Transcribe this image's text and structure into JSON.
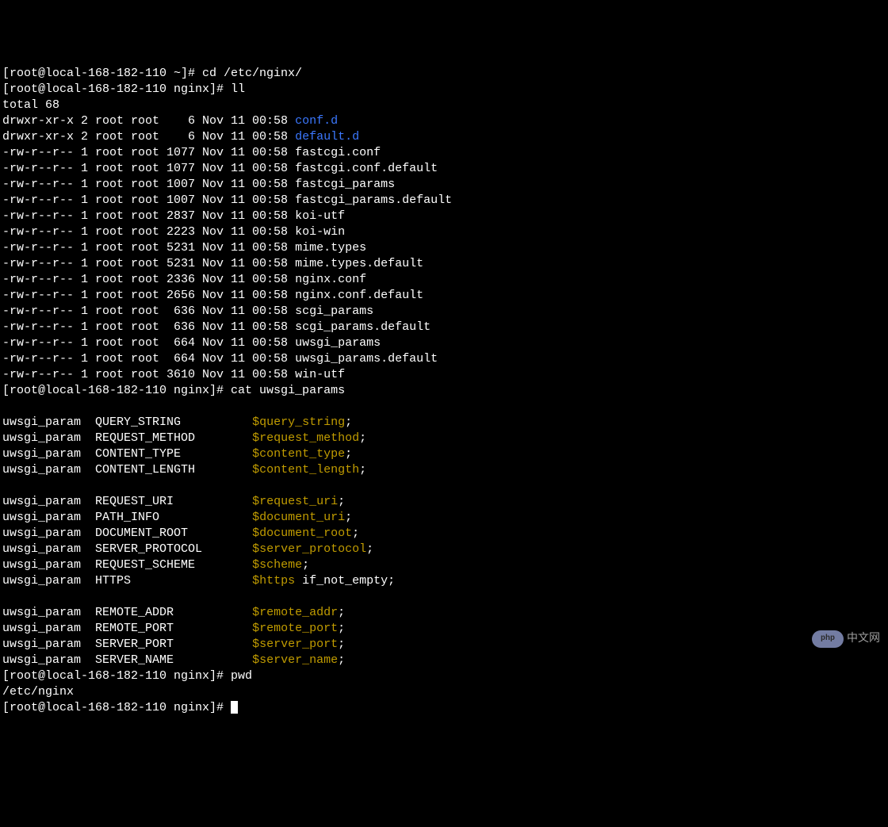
{
  "prompts": {
    "host_home": "[root@local-168-182-110 ~]#",
    "host_nginx": "[root@local-168-182-110 nginx]#"
  },
  "commands": {
    "cd": "cd /etc/nginx/",
    "ll": "ll",
    "cat": "cat uwsgi_params",
    "pwd": "pwd",
    "pwd_output": "/etc/nginx"
  },
  "ll_total": "total 68",
  "ll_rows": [
    {
      "perm": "drwxr-xr-x",
      "links": "2",
      "owner": "root",
      "group": "root",
      "size": "6",
      "month": "Nov",
      "day": "11",
      "time": "00:58",
      "name": "conf.d",
      "type": "dir"
    },
    {
      "perm": "drwxr-xr-x",
      "links": "2",
      "owner": "root",
      "group": "root",
      "size": "6",
      "month": "Nov",
      "day": "11",
      "time": "00:58",
      "name": "default.d",
      "type": "dir"
    },
    {
      "perm": "-rw-r--r--",
      "links": "1",
      "owner": "root",
      "group": "root",
      "size": "1077",
      "month": "Nov",
      "day": "11",
      "time": "00:58",
      "name": "fastcgi.conf",
      "type": "file"
    },
    {
      "perm": "-rw-r--r--",
      "links": "1",
      "owner": "root",
      "group": "root",
      "size": "1077",
      "month": "Nov",
      "day": "11",
      "time": "00:58",
      "name": "fastcgi.conf.default",
      "type": "file"
    },
    {
      "perm": "-rw-r--r--",
      "links": "1",
      "owner": "root",
      "group": "root",
      "size": "1007",
      "month": "Nov",
      "day": "11",
      "time": "00:58",
      "name": "fastcgi_params",
      "type": "file"
    },
    {
      "perm": "-rw-r--r--",
      "links": "1",
      "owner": "root",
      "group": "root",
      "size": "1007",
      "month": "Nov",
      "day": "11",
      "time": "00:58",
      "name": "fastcgi_params.default",
      "type": "file"
    },
    {
      "perm": "-rw-r--r--",
      "links": "1",
      "owner": "root",
      "group": "root",
      "size": "2837",
      "month": "Nov",
      "day": "11",
      "time": "00:58",
      "name": "koi-utf",
      "type": "file"
    },
    {
      "perm": "-rw-r--r--",
      "links": "1",
      "owner": "root",
      "group": "root",
      "size": "2223",
      "month": "Nov",
      "day": "11",
      "time": "00:58",
      "name": "koi-win",
      "type": "file"
    },
    {
      "perm": "-rw-r--r--",
      "links": "1",
      "owner": "root",
      "group": "root",
      "size": "5231",
      "month": "Nov",
      "day": "11",
      "time": "00:58",
      "name": "mime.types",
      "type": "file"
    },
    {
      "perm": "-rw-r--r--",
      "links": "1",
      "owner": "root",
      "group": "root",
      "size": "5231",
      "month": "Nov",
      "day": "11",
      "time": "00:58",
      "name": "mime.types.default",
      "type": "file"
    },
    {
      "perm": "-rw-r--r--",
      "links": "1",
      "owner": "root",
      "group": "root",
      "size": "2336",
      "month": "Nov",
      "day": "11",
      "time": "00:58",
      "name": "nginx.conf",
      "type": "file"
    },
    {
      "perm": "-rw-r--r--",
      "links": "1",
      "owner": "root",
      "group": "root",
      "size": "2656",
      "month": "Nov",
      "day": "11",
      "time": "00:58",
      "name": "nginx.conf.default",
      "type": "file"
    },
    {
      "perm": "-rw-r--r--",
      "links": "1",
      "owner": "root",
      "group": "root",
      "size": "636",
      "month": "Nov",
      "day": "11",
      "time": "00:58",
      "name": "scgi_params",
      "type": "file"
    },
    {
      "perm": "-rw-r--r--",
      "links": "1",
      "owner": "root",
      "group": "root",
      "size": "636",
      "month": "Nov",
      "day": "11",
      "time": "00:58",
      "name": "scgi_params.default",
      "type": "file"
    },
    {
      "perm": "-rw-r--r--",
      "links": "1",
      "owner": "root",
      "group": "root",
      "size": "664",
      "month": "Nov",
      "day": "11",
      "time": "00:58",
      "name": "uwsgi_params",
      "type": "file"
    },
    {
      "perm": "-rw-r--r--",
      "links": "1",
      "owner": "root",
      "group": "root",
      "size": "664",
      "month": "Nov",
      "day": "11",
      "time": "00:58",
      "name": "uwsgi_params.default",
      "type": "file"
    },
    {
      "perm": "-rw-r--r--",
      "links": "1",
      "owner": "root",
      "group": "root",
      "size": "3610",
      "month": "Nov",
      "day": "11",
      "time": "00:58",
      "name": "win-utf",
      "type": "file"
    }
  ],
  "uwsgi_groups": [
    [
      {
        "directive": "uwsgi_param",
        "key": "QUERY_STRING",
        "value": "$query_string",
        "suffix": ";"
      },
      {
        "directive": "uwsgi_param",
        "key": "REQUEST_METHOD",
        "value": "$request_method",
        "suffix": ";"
      },
      {
        "directive": "uwsgi_param",
        "key": "CONTENT_TYPE",
        "value": "$content_type",
        "suffix": ";"
      },
      {
        "directive": "uwsgi_param",
        "key": "CONTENT_LENGTH",
        "value": "$content_length",
        "suffix": ";"
      }
    ],
    [
      {
        "directive": "uwsgi_param",
        "key": "REQUEST_URI",
        "value": "$request_uri",
        "suffix": ";"
      },
      {
        "directive": "uwsgi_param",
        "key": "PATH_INFO",
        "value": "$document_uri",
        "suffix": ";"
      },
      {
        "directive": "uwsgi_param",
        "key": "DOCUMENT_ROOT",
        "value": "$document_root",
        "suffix": ";"
      },
      {
        "directive": "uwsgi_param",
        "key": "SERVER_PROTOCOL",
        "value": "$server_protocol",
        "suffix": ";"
      },
      {
        "directive": "uwsgi_param",
        "key": "REQUEST_SCHEME",
        "value": "$scheme",
        "suffix": ";"
      },
      {
        "directive": "uwsgi_param",
        "key": "HTTPS",
        "value": "$https",
        "suffix": " if_not_empty;"
      }
    ],
    [
      {
        "directive": "uwsgi_param",
        "key": "REMOTE_ADDR",
        "value": "$remote_addr",
        "suffix": ";"
      },
      {
        "directive": "uwsgi_param",
        "key": "REMOTE_PORT",
        "value": "$remote_port",
        "suffix": ";"
      },
      {
        "directive": "uwsgi_param",
        "key": "SERVER_PORT",
        "value": "$server_port",
        "suffix": ";"
      },
      {
        "directive": "uwsgi_param",
        "key": "SERVER_NAME",
        "value": "$server_name",
        "suffix": ";"
      }
    ]
  ],
  "watermark": {
    "logo_text": "php",
    "cn_text": "中文网"
  }
}
